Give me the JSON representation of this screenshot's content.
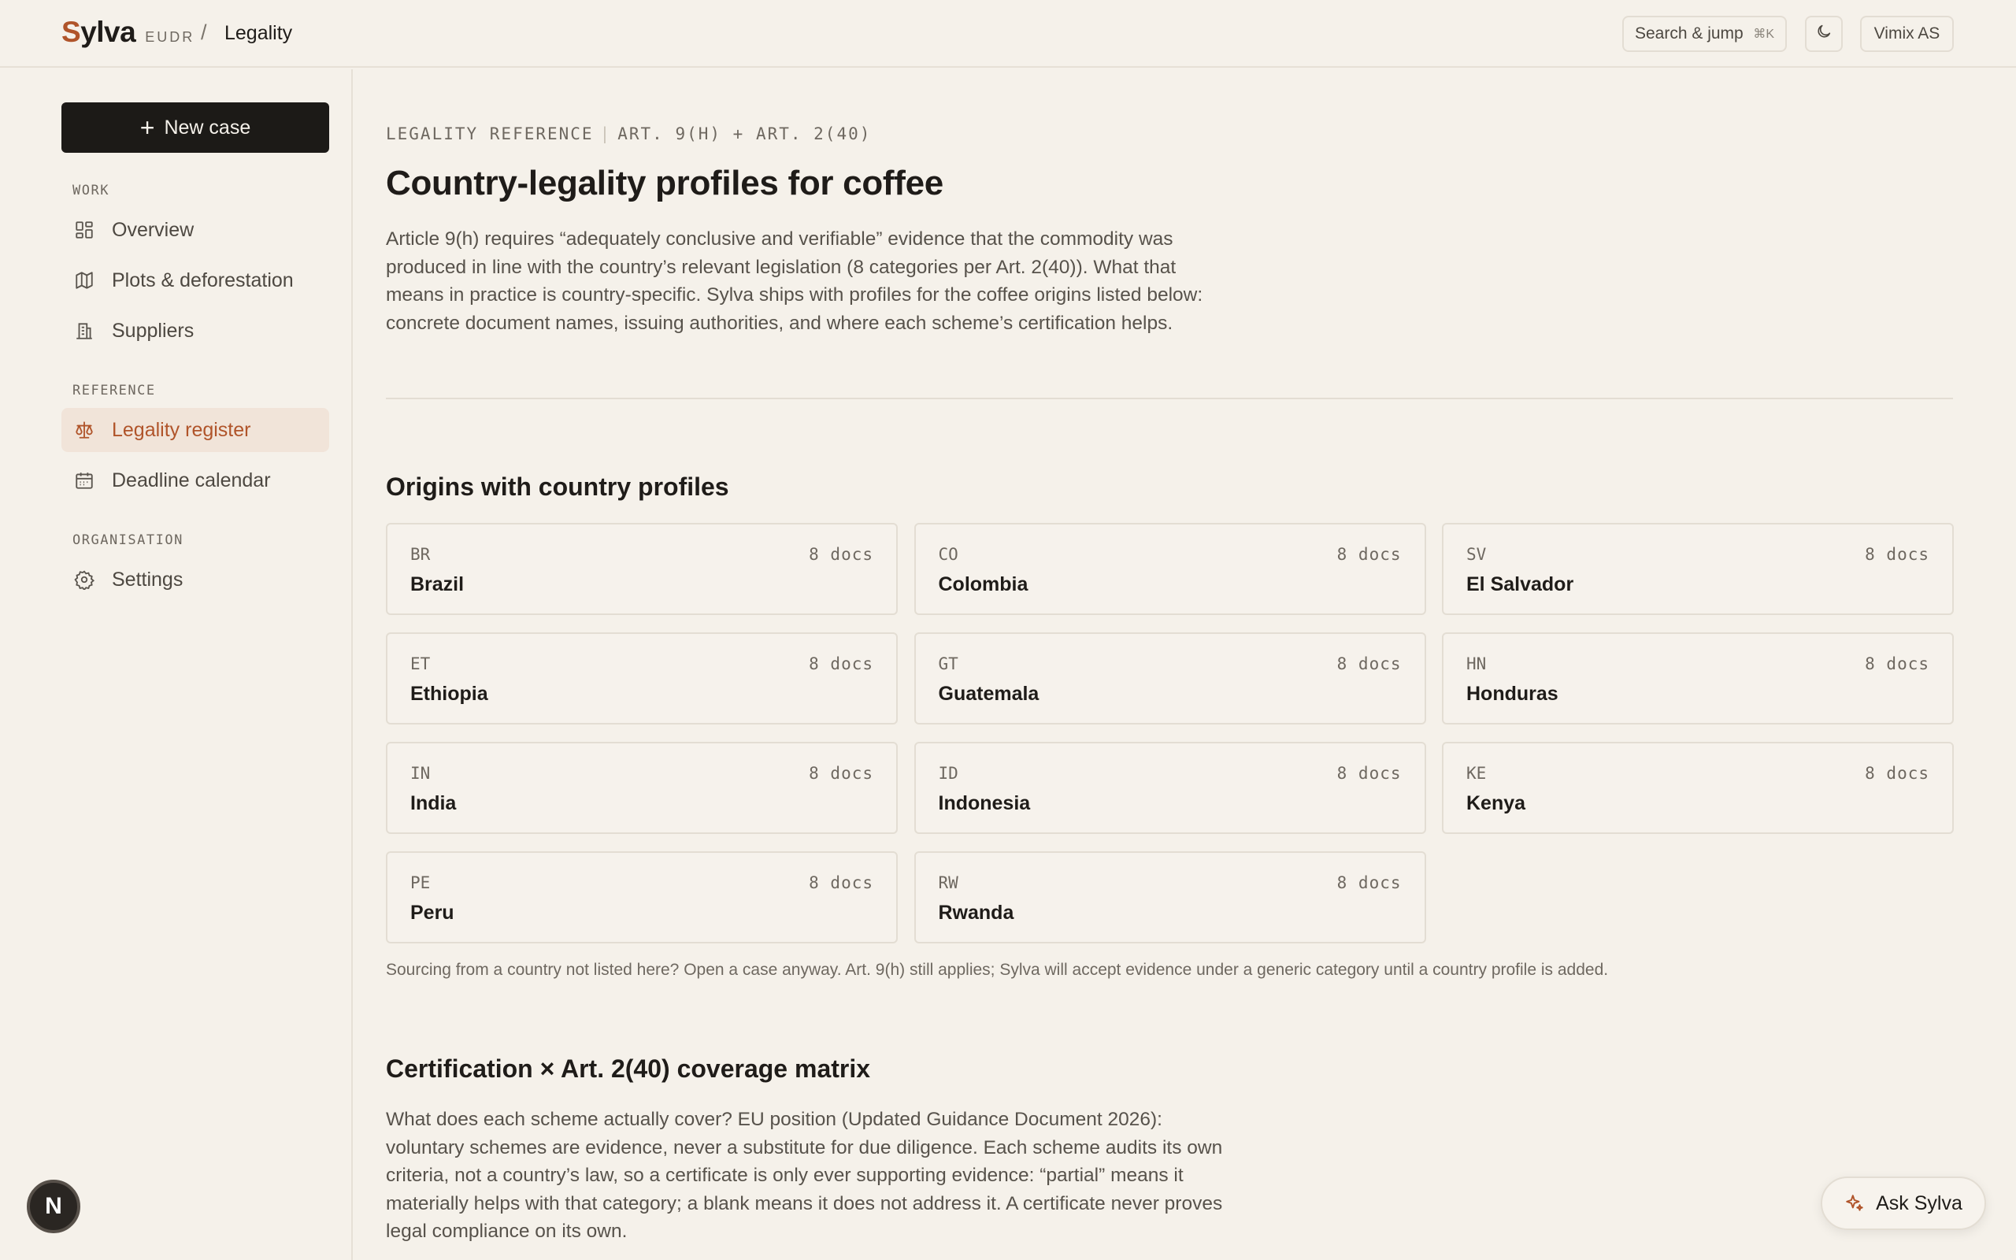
{
  "header": {
    "brand_first": "S",
    "brand_rest": "ylva",
    "brand_tag": "EUDR",
    "separator": "/",
    "crumb": "Legality",
    "search_label": "Search & jump",
    "search_shortcut": "⌘K",
    "org_label": "Vimix AS",
    "theme_icon": "moon-icon"
  },
  "sidebar": {
    "new_case_label": "New case",
    "sections": {
      "work": "WORK",
      "reference": "REFERENCE",
      "organisation": "ORGANISATION"
    },
    "items": [
      {
        "label": "Overview",
        "icon": "dashboard-grid-icon"
      },
      {
        "label": "Plots & deforestation",
        "icon": "map-icon"
      },
      {
        "label": "Suppliers",
        "icon": "building-icon"
      },
      {
        "label": "Legality register",
        "icon": "scales-icon",
        "active": true
      },
      {
        "label": "Deadline calendar",
        "icon": "calendar-icon"
      },
      {
        "label": "Settings",
        "icon": "gear-icon"
      }
    ],
    "avatar_letter": "N"
  },
  "main": {
    "eyebrow_left": "LEGALITY REFERENCE",
    "eyebrow_right": "ART. 9(H) + ART. 2(40)",
    "title": "Country-legality profiles for coffee",
    "intro": "Article 9(h) requires “adequately conclusive and verifiable” evidence that the commodity was produced in line with the country’s relevant legislation (8 categories per Art. 2(40)). What that means in practice is country-specific. Sylva ships with profiles for the coffee origins listed below: concrete document names, issuing authorities, and where each scheme’s certification helps.",
    "origins_title": "Origins with country profiles",
    "origins": [
      {
        "code": "BR",
        "name": "Brazil",
        "docs": "8 docs"
      },
      {
        "code": "CO",
        "name": "Colombia",
        "docs": "8 docs"
      },
      {
        "code": "SV",
        "name": "El Salvador",
        "docs": "8 docs"
      },
      {
        "code": "ET",
        "name": "Ethiopia",
        "docs": "8 docs"
      },
      {
        "code": "GT",
        "name": "Guatemala",
        "docs": "8 docs"
      },
      {
        "code": "HN",
        "name": "Honduras",
        "docs": "8 docs"
      },
      {
        "code": "IN",
        "name": "India",
        "docs": "8 docs"
      },
      {
        "code": "ID",
        "name": "Indonesia",
        "docs": "8 docs"
      },
      {
        "code": "KE",
        "name": "Kenya",
        "docs": "8 docs"
      },
      {
        "code": "PE",
        "name": "Peru",
        "docs": "8 docs"
      },
      {
        "code": "RW",
        "name": "Rwanda",
        "docs": "8 docs"
      }
    ],
    "footnote": "Sourcing from a country not listed here? Open a case anyway. Art. 9(h) still applies; Sylva will accept evidence under a generic category until a country profile is added.",
    "matrix_title": "Certification × Art. 2(40) coverage matrix",
    "matrix_intro": "What does each scheme actually cover? EU position (Updated Guidance Document 2026): voluntary schemes are evidence, never a substitute for due diligence. Each scheme audits its own criteria, not a country’s law, so a certificate is only ever supporting evidence: “partial” means it materially helps with that category; a blank means it does not address it. A certificate never proves legal compliance on its own."
  },
  "assistant": {
    "label": "Ask Sylva",
    "icon": "sparkle-icon"
  },
  "colors": {
    "background": "#f5f1ea",
    "accent": "#b0542a",
    "active_bg": "#f1e4d9",
    "primary_button": "#1c1a17"
  }
}
